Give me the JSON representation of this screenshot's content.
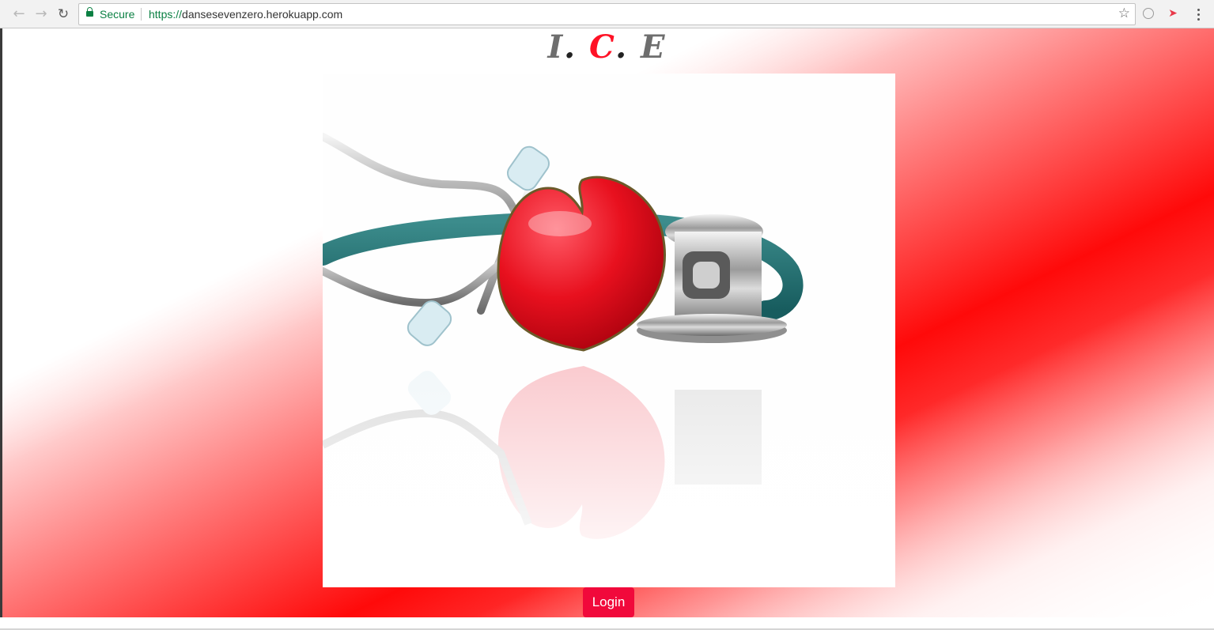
{
  "browser": {
    "secure_label": "Secure",
    "url_scheme": "https://",
    "url_host": "dansesevenzero.herokuapp.com"
  },
  "logo": {
    "letter_1": "I",
    "dot_1": ".",
    "letter_2": "C",
    "dot_2": ".",
    "letter_3": "E"
  },
  "hero": {
    "description": ""
  },
  "login": {
    "label": "Login"
  },
  "colors": {
    "accent": "#f1093b",
    "logo_red": "#ff1226",
    "logo_grey": "#6e6e6e",
    "secure_green": "#0b8043"
  },
  "icons": {
    "back": "arrow-left-icon",
    "forward": "arrow-right-icon",
    "reload": "reload-icon",
    "lock": "lock-icon",
    "bookmark": "star-icon",
    "extension_1": "circle-extension-icon",
    "extension_2": "red-extension-icon",
    "menu": "kebab-menu-icon"
  }
}
